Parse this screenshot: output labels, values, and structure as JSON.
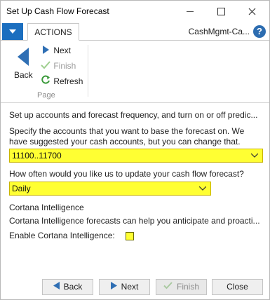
{
  "window": {
    "title": "Set Up Cash Flow Forecast"
  },
  "tabs": {
    "actions_label": "ACTIONS",
    "company_label": "CashMgmt-Ca..."
  },
  "ribbon": {
    "back_label": "Back",
    "next_label": "Next",
    "finish_label": "Finish",
    "refresh_label": "Refresh",
    "group_label": "Page"
  },
  "content": {
    "intro": "Set up accounts and forecast frequency, and turn on or off predic...",
    "accounts_text_1": "Specify the accounts that you want to base the forecast on. We",
    "accounts_text_2": "have suggested your cash accounts, but you can change that.",
    "accounts_value": "11100..11700",
    "frequency_text": "How often would you like us to update your cash flow forecast?",
    "frequency_value": "Daily",
    "cortana_heading": "Cortana Intelligence",
    "cortana_text": "Cortana Intelligence forecasts can help you anticipate and proacti...",
    "cortana_enable_label": "Enable Cortana Intelligence:",
    "cortana_enabled": false
  },
  "footer": {
    "back_label": "Back",
    "next_label": "Next",
    "finish_label": "Finish",
    "close_label": "Close"
  },
  "colors": {
    "accent": "#1b6ebf",
    "field_highlight": "#ffff33",
    "arrow_blue": "#2f6fb4",
    "finish_check": "#7fbf6a"
  }
}
